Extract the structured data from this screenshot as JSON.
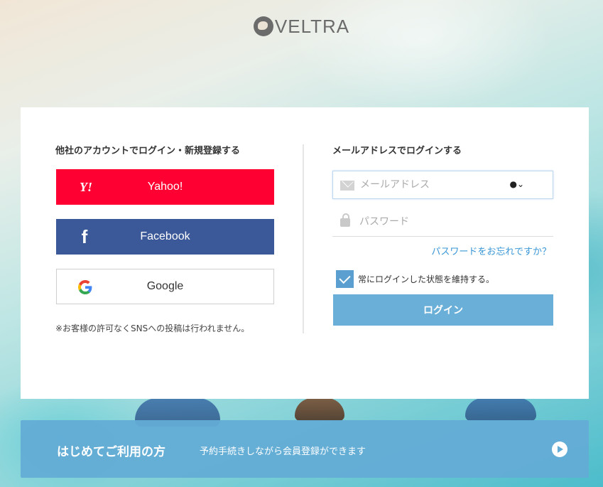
{
  "logo": {
    "text": "VELTRA"
  },
  "social": {
    "title": "他社のアカウントでログイン・新規登録する",
    "yahoo": {
      "label": "Yahoo!",
      "icon": "Y!"
    },
    "facebook": {
      "label": "Facebook",
      "icon": "f"
    },
    "google": {
      "label": "Google"
    },
    "note": "※お客様の許可なくSNSへの投稿は行われません。"
  },
  "email_login": {
    "title": "メールアドレスでログインする",
    "email_placeholder": "メールアドレス",
    "password_placeholder": "パスワード",
    "forgot_link": "パスワードをお忘れですか？",
    "remember_label": "常にログインした状態を維持する。",
    "remember_checked": true,
    "login_button": "ログイン"
  },
  "signup": {
    "title": "はじめてご利用の方",
    "description": "予約手続きしながら会員登録ができます"
  },
  "colors": {
    "yahoo": "#ff0033",
    "facebook": "#3b5998",
    "accent": "#6aafd8",
    "link": "#3a97d6"
  }
}
